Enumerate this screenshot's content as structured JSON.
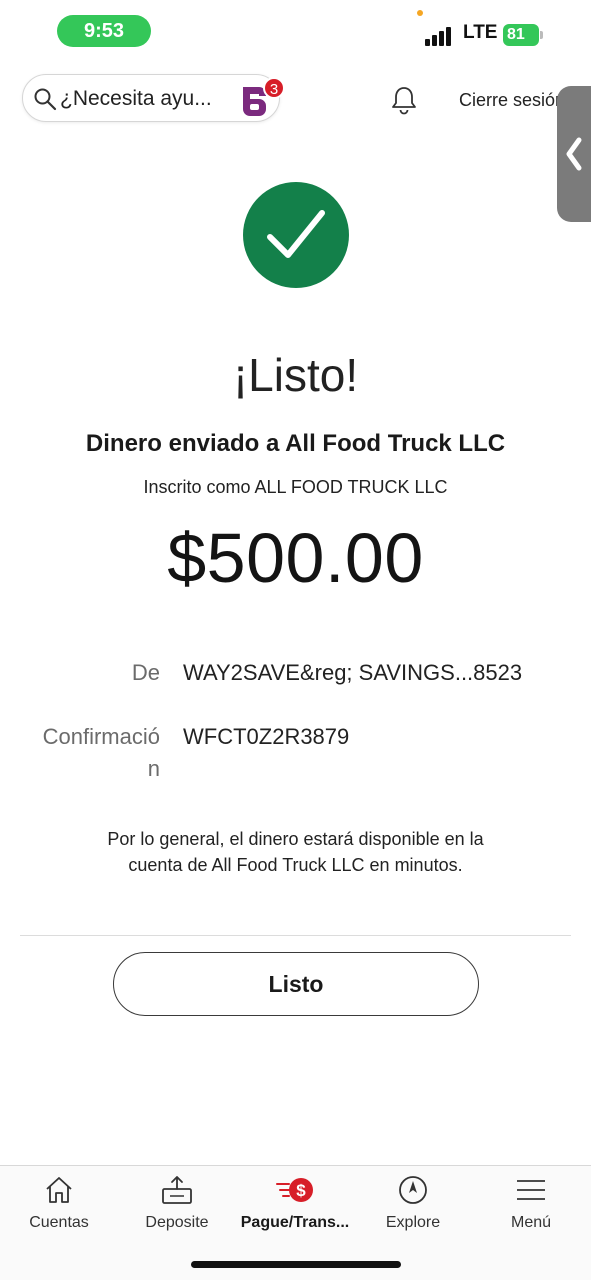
{
  "status_bar": {
    "time": "9:53",
    "network": "LTE",
    "battery": "81"
  },
  "header": {
    "search_placeholder": "¿Necesita ayu...",
    "assistant_badge": "3",
    "logout_label": "Cierre sesión"
  },
  "confirmation": {
    "title": "¡Listo!",
    "sent_to": "Dinero enviado a All Food Truck LLC",
    "enrolled_as": "Inscrito como ALL FOOD TRUCK LLC",
    "amount": "$500.00",
    "from_label": "De",
    "from_value": "WAY2SAVE&reg; SAVINGS...8523",
    "confirmation_label_line1": "Confirmació",
    "confirmation_label_line2": "n",
    "confirmation_value": "WFCT0Z2R3879",
    "note": "Por lo general, el dinero estará disponible en la cuenta de All Food Truck LLC en minutos.",
    "done_button": "Listo"
  },
  "colors": {
    "success": "#13804a",
    "brand_red": "#d71e28",
    "assistant_purple": "#7b2a7e"
  },
  "bottom_nav": [
    {
      "label": "Cuentas",
      "icon": "home-icon",
      "active": false
    },
    {
      "label": "Deposite",
      "icon": "deposit-icon",
      "active": false
    },
    {
      "label": "Pague/Trans...",
      "icon": "pay-transfer-icon",
      "active": true
    },
    {
      "label": "Explore",
      "icon": "compass-icon",
      "active": false
    },
    {
      "label": "Menú",
      "icon": "menu-icon",
      "active": false
    }
  ]
}
